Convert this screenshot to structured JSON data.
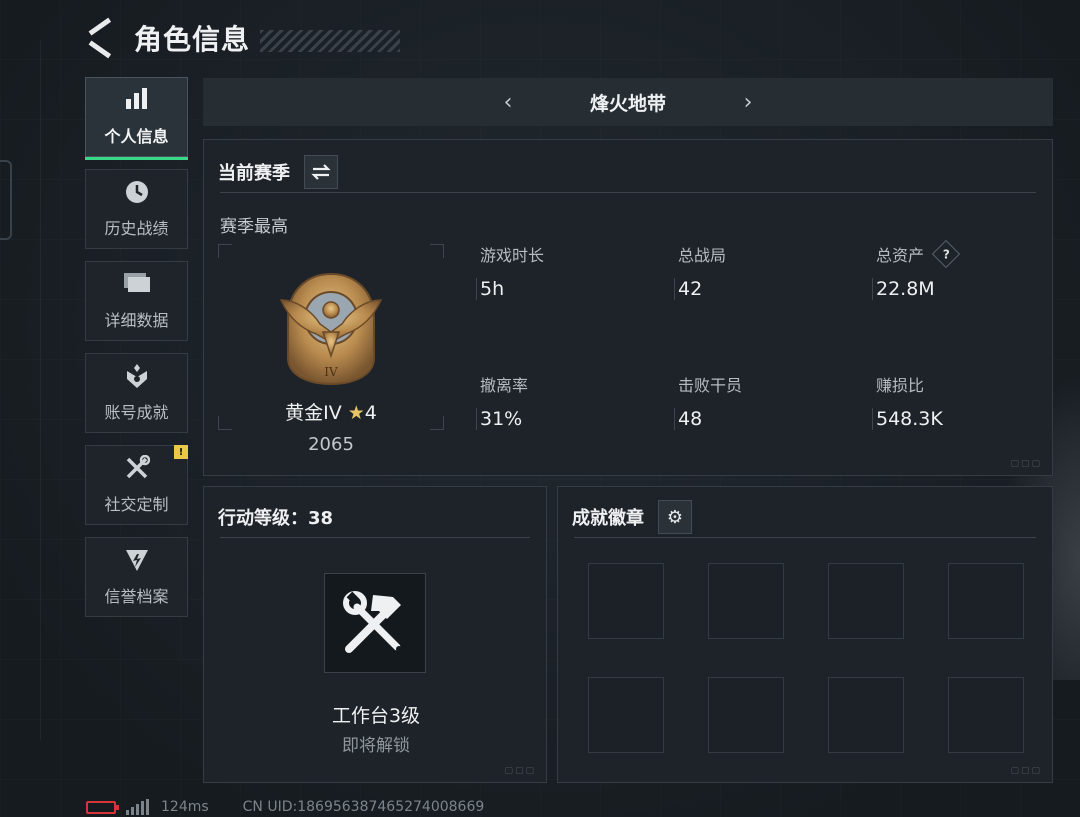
{
  "header": {
    "title": "角色信息"
  },
  "sidebar": {
    "items": [
      {
        "label": "个人信息",
        "icon": "bar-chart-icon",
        "active": true
      },
      {
        "label": "历史战绩",
        "icon": "clock-icon"
      },
      {
        "label": "详细数据",
        "icon": "folder-icon"
      },
      {
        "label": "账号成就",
        "icon": "achievement-icon"
      },
      {
        "label": "社交定制",
        "icon": "tools-icon",
        "badge": "!"
      },
      {
        "label": "信誉档案",
        "icon": "credit-icon"
      }
    ]
  },
  "mode": {
    "title": "烽火地带",
    "prev": "‹",
    "next": "›"
  },
  "season": {
    "title": "当前赛季",
    "subtitle": "赛季最高",
    "rank": {
      "name": "黄金IV",
      "stars": "4",
      "score": "2065",
      "medal_numeral": "IV"
    },
    "stats": [
      {
        "label": "游戏时长",
        "value": "5h"
      },
      {
        "label": "总战局",
        "value": "42"
      },
      {
        "label": "总资产",
        "value": "22.8M",
        "help": "?"
      },
      {
        "label": "撤离率",
        "value": "31%"
      },
      {
        "label": "击败干员",
        "value": "48"
      },
      {
        "label": "赚损比",
        "value": "548.3K"
      }
    ]
  },
  "level": {
    "title": "行动等级：38",
    "unlock_name": "工作台3级",
    "unlock_status": "即将解锁"
  },
  "badges": {
    "title": "成就徽章",
    "slots": 8
  },
  "footer": {
    "ping": "124ms",
    "uid": "CN UID:18695638746527400866​9"
  },
  "colors": {
    "accent_green": "#39d98a",
    "badge_yellow": "#e9c84a",
    "battery_red": "#d6343a"
  }
}
